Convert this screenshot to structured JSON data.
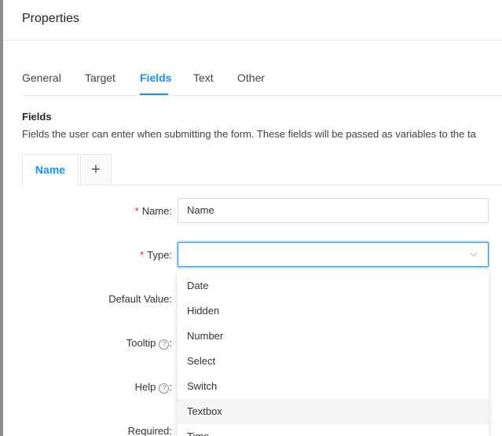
{
  "header": {
    "title": "Properties"
  },
  "tabs": [
    {
      "label": "General"
    },
    {
      "label": "Target"
    },
    {
      "label": "Fields"
    },
    {
      "label": "Text"
    },
    {
      "label": "Other"
    }
  ],
  "section": {
    "title": "Fields",
    "description": "Fields the user can enter when submitting the form. These fields will be passed as variables to the ta"
  },
  "field_tabs": {
    "active": "Name",
    "add_label": "+"
  },
  "form": {
    "name_label": "Name",
    "name_value": "Name",
    "type_label": "Type",
    "type_value": "",
    "default_value_label": "Default Value",
    "tooltip_label": "Tooltip",
    "help_label": "Help",
    "required_label": "Required",
    "colon": ":",
    "required_marker": "*",
    "help_glyph": "?"
  },
  "dropdown": {
    "options": [
      "Date",
      "Hidden",
      "Number",
      "Select",
      "Switch",
      "Textbox",
      "Time"
    ],
    "hovered": "Textbox"
  },
  "colors": {
    "accent": "#1890ff",
    "required": "#f5222d"
  }
}
